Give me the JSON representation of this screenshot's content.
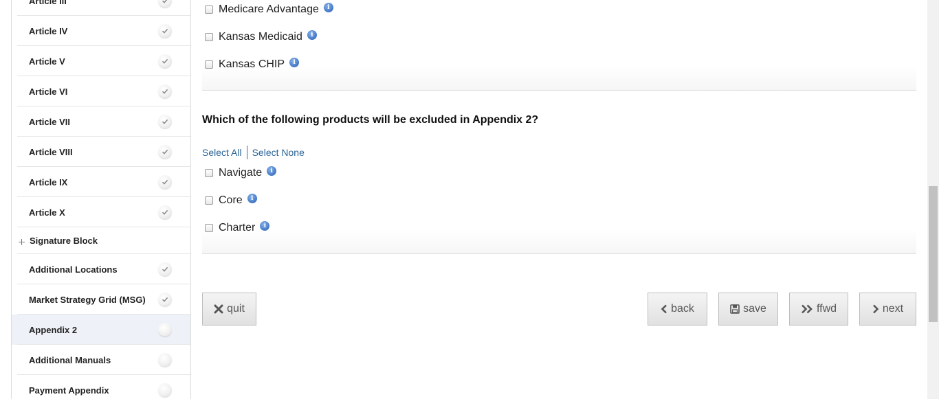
{
  "sidebar": {
    "items": [
      {
        "label": "Article III",
        "status": "complete"
      },
      {
        "label": "Article IV",
        "status": "complete"
      },
      {
        "label": "Article V",
        "status": "complete"
      },
      {
        "label": "Article VI",
        "status": "complete"
      },
      {
        "label": "Article VII",
        "status": "complete"
      },
      {
        "label": "Article VIII",
        "status": "complete"
      },
      {
        "label": "Article IX",
        "status": "complete"
      },
      {
        "label": "Article X",
        "status": "complete"
      },
      {
        "label": "Signature Block",
        "status": "group"
      },
      {
        "label": "Additional Locations",
        "status": "complete"
      },
      {
        "label": "Market Strategy Grid (MSG)",
        "status": "complete"
      },
      {
        "label": "Appendix 2",
        "status": "current"
      },
      {
        "label": "Additional Manuals",
        "status": "incomplete"
      },
      {
        "label": "Payment Appendix",
        "status": "incomplete"
      }
    ]
  },
  "main": {
    "prev_options": [
      {
        "label": "Medicare Advantage",
        "checked": false
      },
      {
        "label": "Kansas Medicaid",
        "checked": false
      },
      {
        "label": "Kansas CHIP",
        "checked": false
      }
    ],
    "question": "Which of the following products will be excluded in Appendix 2?",
    "select_all": "Select All",
    "select_none": "Select None",
    "options": [
      {
        "label": "Navigate",
        "checked": false
      },
      {
        "label": "Core",
        "checked": false
      },
      {
        "label": "Charter",
        "checked": false
      }
    ],
    "info_glyph": "i"
  },
  "buttons": {
    "quit": "quit",
    "back": "back",
    "save": "save",
    "ffwd": "ffwd",
    "next": "next"
  },
  "colors": {
    "link": "#2a6496",
    "active_item_bg": "#eef2f8",
    "info_icon": "#4a7fcb"
  }
}
